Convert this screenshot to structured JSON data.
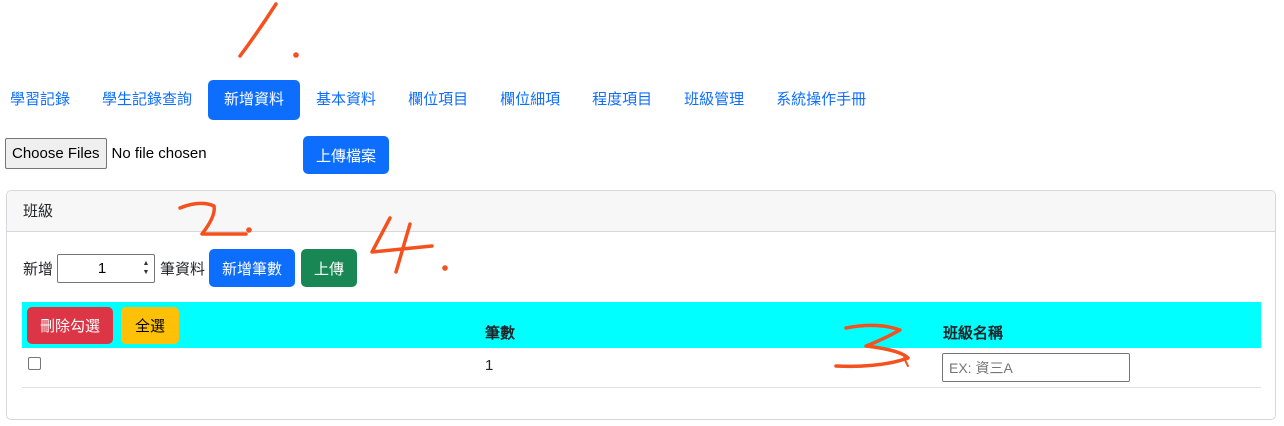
{
  "nav": {
    "items": [
      "學習記錄",
      "學生記錄查詢",
      "新增資料",
      "基本資料",
      "欄位項目",
      "欄位細項",
      "程度項目",
      "班級管理",
      "系統操作手冊"
    ],
    "active": "新增資料"
  },
  "file": {
    "choose_label": "Choose Files",
    "status_text": "No file chosen",
    "upload_label": "上傳檔案"
  },
  "card": {
    "header": "班級",
    "add_prefix": "新增",
    "add_count": "1",
    "add_suffix": "筆資料",
    "add_button": "新增筆數",
    "upload_button": "上傳"
  },
  "table": {
    "delete_button": "刪除勾選",
    "select_all_button": "全選",
    "headers": {
      "count": "筆數",
      "class_name": "班級名稱"
    },
    "rows": [
      {
        "count": "1",
        "class_name_value": "",
        "class_name_placeholder": "EX: 資三A"
      }
    ]
  },
  "annotations": {
    "mark1": "1.",
    "mark2": "2.",
    "mark3": "3.",
    "mark4": "4.",
    "color": "#f4511e"
  },
  "colors": {
    "primary": "#0d6efd",
    "success": "#198754",
    "danger": "#dc3545",
    "warning": "#ffc107",
    "table_header": "#00ffff"
  }
}
